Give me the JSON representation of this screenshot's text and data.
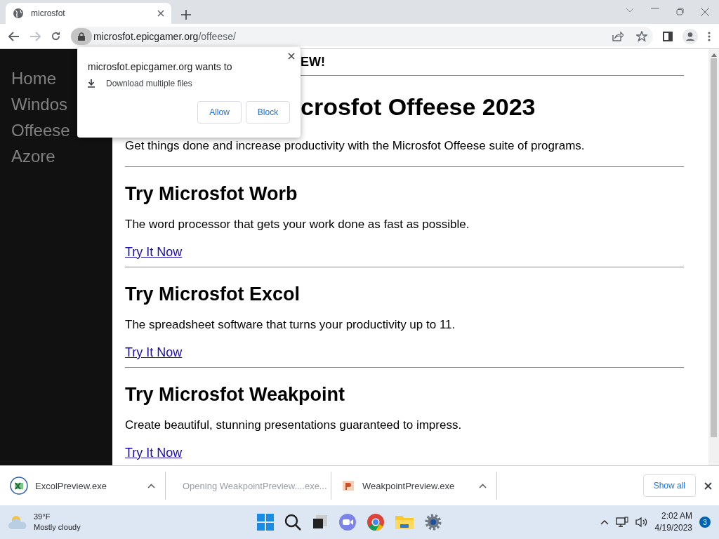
{
  "browser": {
    "tabs": [
      {
        "title": "microsfot",
        "selected": true
      }
    ],
    "address_host": "microsfot.epicgamer.org",
    "address_path": "/offeese/"
  },
  "permission_popup": {
    "message": "microsfot.epicgamer.org wants to",
    "request": "Download multiple files",
    "buttons": [
      "Allow",
      "Block"
    ]
  },
  "sidebar": {
    "items": [
      "Home",
      "Windos",
      "Offeese",
      "Azore"
    ]
  },
  "page": {
    "banner": "EW!",
    "title": "crosfot Offeese 2023",
    "intro": "Get things done and increase productivity with the Microsfot Offeese suite of programs.",
    "sections": [
      {
        "heading": "Try Microsfot Worb",
        "text": "The word processor that gets your work done as fast as possible.",
        "link": "Try It Now"
      },
      {
        "heading": "Try Microsfot Excol",
        "text": "The spreadsheet software that turns your productivity up to 11.",
        "link": "Try It Now"
      },
      {
        "heading": "Try Microsfot Weakpoint",
        "text": "Create beautiful, stunning presentations guaranteed to impress.",
        "link": "Try It Now"
      }
    ]
  },
  "downloads": {
    "items": [
      {
        "name": "ExcolPreview.exe",
        "kind": "sheet",
        "opening": false
      },
      {
        "name": "Opening WeakpointPreview....exe...",
        "kind": "slides",
        "opening": true
      },
      {
        "name": "WeakpointPreview.exe",
        "kind": "slides",
        "opening": false
      }
    ],
    "show_all": "Show all"
  },
  "taskbar": {
    "temperature": "39°F",
    "weather": "Mostly cloudy",
    "time": "2:02 AM",
    "date": "4/19/2023",
    "notifications": "3"
  }
}
